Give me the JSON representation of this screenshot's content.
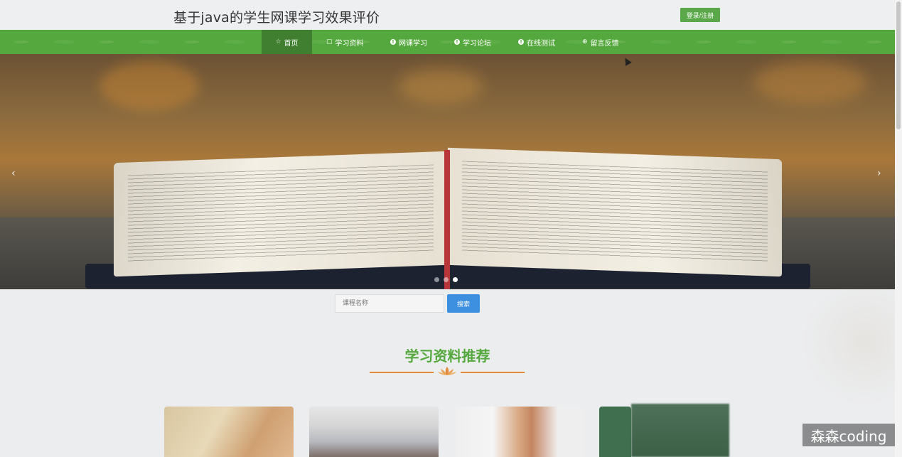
{
  "header": {
    "site_title": "基于java的学生网课学习效果评价",
    "login_label": "登录/注册"
  },
  "nav": {
    "items": [
      {
        "label": "首页",
        "icon": "star-icon"
      },
      {
        "label": "学习资料",
        "icon": "bag-icon"
      },
      {
        "label": "网课学习",
        "icon": "info-icon"
      },
      {
        "label": "学习论坛",
        "icon": "info-icon"
      },
      {
        "label": "在线测试",
        "icon": "info-icon"
      },
      {
        "label": "留言反馈",
        "icon": "globe-icon"
      }
    ],
    "active": "首页"
  },
  "banner": {
    "prev_arrow": "‹",
    "next_arrow": "›",
    "slide_count": 3,
    "active_slide": 3
  },
  "search": {
    "placeholder": "课程名称",
    "button_label": "搜索"
  },
  "section": {
    "title": "学习资料推荐"
  },
  "watermark": "森森coding",
  "colors": {
    "brand_green": "#55a83d",
    "nav_active": "#3f7f2f",
    "search_blue": "#3d8fe0",
    "divider_orange": "#e38a3a"
  }
}
